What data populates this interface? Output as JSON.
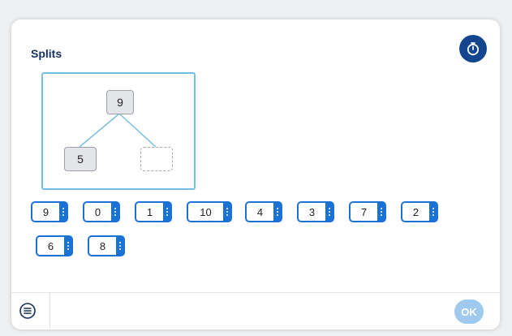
{
  "title": "Splits",
  "diagram": {
    "top": "9",
    "left": "5",
    "right": ""
  },
  "chips": [
    "9",
    "0",
    "1",
    "10",
    "4",
    "3",
    "7",
    "2",
    "6",
    "8"
  ],
  "footer": {
    "ok_label": "OK"
  },
  "colors": {
    "accent": "#1a73d4",
    "timer": "#14468f",
    "ok_disabled": "#9fc9ef",
    "diagram_border": "#76bde3"
  }
}
